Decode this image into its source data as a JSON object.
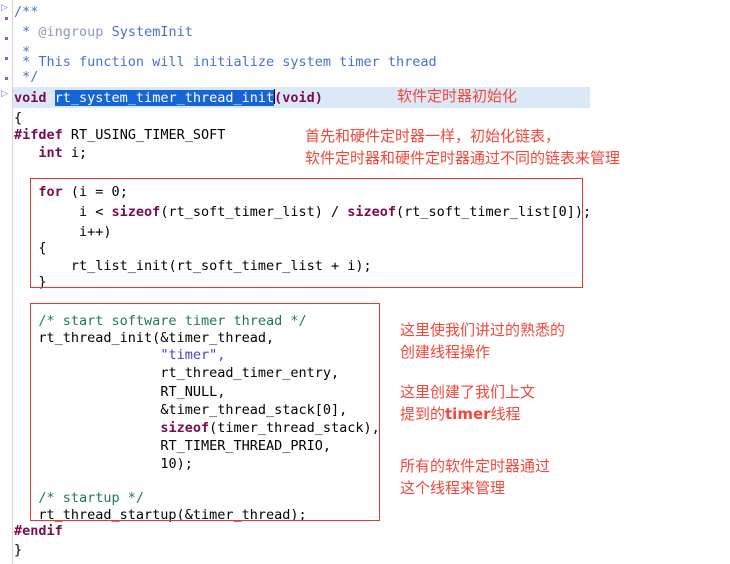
{
  "editor": {
    "title": "rt_system_timer_thread_init source view",
    "language": "c",
    "background": "#ffffff",
    "line_highlight_color": "#dbe9f7",
    "selection_color": "#1565d8",
    "annotation_color": "#f4473a",
    "box_border_color": "#e8392a"
  },
  "gutter": {
    "fold_markers": [
      "▫",
      "▫"
    ],
    "dot_color": "#9b59b6"
  },
  "code": {
    "lines": [
      {
        "id": "l01",
        "text": "/**"
      },
      {
        "id": "l02",
        "text": " * @ingroup SystemInit"
      },
      {
        "id": "l03",
        "text": " *"
      },
      {
        "id": "l04",
        "text": " * This function will initialize system timer thread"
      },
      {
        "id": "l05",
        "text": " */"
      },
      {
        "id": "l06",
        "text": "void rt_system_timer_thread_init(void)"
      },
      {
        "id": "l07",
        "text": "{"
      },
      {
        "id": "l08",
        "text": "#ifdef RT_USING_TIMER_SOFT"
      },
      {
        "id": "l09",
        "text": "    int i;"
      },
      {
        "id": "l10",
        "text": ""
      },
      {
        "id": "l11",
        "text": "    for (i = 0;"
      },
      {
        "id": "l12",
        "text": "         i < sizeof(rt_soft_timer_list) / sizeof(rt_soft_timer_list[0]);"
      },
      {
        "id": "l13",
        "text": "         i++)"
      },
      {
        "id": "l14",
        "text": "    {"
      },
      {
        "id": "l15",
        "text": "        rt_list_init(rt_soft_timer_list + i);"
      },
      {
        "id": "l16",
        "text": "    }"
      },
      {
        "id": "l17",
        "text": ""
      },
      {
        "id": "l18",
        "text": "    /* start software timer thread */"
      },
      {
        "id": "l19",
        "text": "    rt_thread_init(&timer_thread,"
      },
      {
        "id": "l20",
        "text": "                   \"timer\","
      },
      {
        "id": "l21",
        "text": "                   rt_thread_timer_entry,"
      },
      {
        "id": "l22",
        "text": "                   RT_NULL,"
      },
      {
        "id": "l23",
        "text": "                   &timer_thread_stack[0],"
      },
      {
        "id": "l24",
        "text": "                   sizeof(timer_thread_stack),"
      },
      {
        "id": "l25",
        "text": "                   RT_TIMER_THREAD_PRIO,"
      },
      {
        "id": "l26",
        "text": "                   10);"
      },
      {
        "id": "l27",
        "text": ""
      },
      {
        "id": "l28",
        "text": "    /* startup */"
      },
      {
        "id": "l29",
        "text": "    rt_thread_startup(&timer_thread);"
      },
      {
        "id": "l30",
        "text": "#endif"
      },
      {
        "id": "l31",
        "text": "}"
      }
    ],
    "tokens": {
      "comment_open": "/**",
      "comment_tag": "@ingroup",
      "comment_tag_value": "SystemInit",
      "comment_star": "*",
      "comment_body": "This function will initialize system timer thread",
      "comment_close": "*/",
      "kw_void": "void",
      "selected_identifier": "rt_system_timer_thread_init",
      "paren_void": "(void)",
      "brace_open": "{",
      "pp_ifdef": "#ifdef",
      "macro_timer_soft": "RT_USING_TIMER_SOFT",
      "kw_int": "int",
      "var_i": "i;",
      "kw_for": "for",
      "for_init": "(i = 0;",
      "kw_sizeof": "sizeof",
      "for_cond_a": "i < ",
      "for_cond_b": "(rt_soft_timer_list) / ",
      "for_cond_c": "(rt_soft_timer_list[0]);",
      "for_incr": "i++)",
      "call_list_init": "rt_list_init(rt_soft_timer_list + i);",
      "brace_close": "}",
      "cmt_start_thread": "/* start software timer thread */",
      "call_thread_init": "rt_thread_init(&timer_thread,",
      "arg_name": "\"timer\",",
      "arg_entry": "rt_thread_timer_entry,",
      "arg_null": "RT_NULL,",
      "arg_stack": "&timer_thread_stack[0],",
      "arg_sizeof_tail": "(timer_thread_stack),",
      "arg_prio": "RT_TIMER_THREAD_PRIO,",
      "arg_tick": "10);",
      "cmt_startup": "/* startup */",
      "call_thread_startup": "rt_thread_startup(&timer_thread);",
      "pp_endif": "#endif"
    }
  },
  "annotations": {
    "title_note": "软件定时器初始化",
    "note_linklist_line1": "首先和硬件定时器一样，初始化链表，",
    "note_linklist_line2": "软件定时器和硬件定时器通过不同的链表来管理",
    "note_thread_line1": "这里使我们讲过的熟悉的",
    "note_thread_line2": "创建线程操作",
    "note_thread_line3": "这里创建了我们上文",
    "note_thread_line4_pre": "提到的",
    "note_thread_line4_bold": "timer",
    "note_thread_line4_post": "线程",
    "note_manage_line1": "所有的软件定时器通过",
    "note_manage_line2": "这个线程来管理"
  },
  "boxes": {
    "for_loop_box_label": "for-loop-highlight-box",
    "thread_init_box_label": "thread-init-highlight-box"
  }
}
